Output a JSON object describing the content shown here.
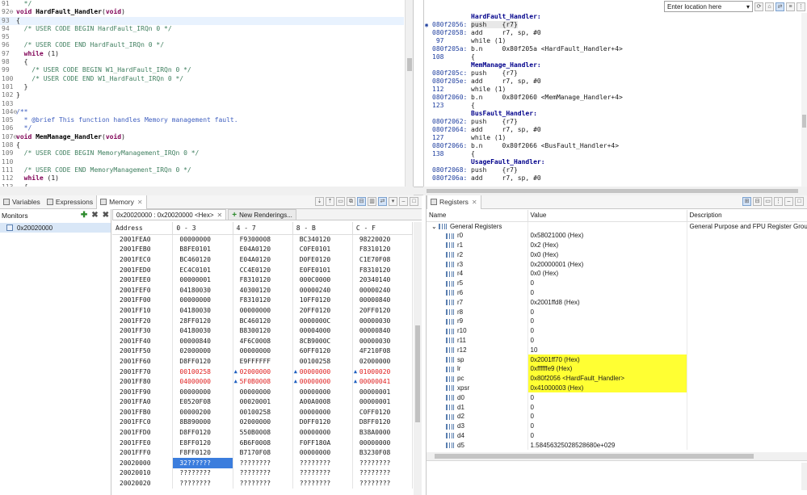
{
  "editor": {
    "lines": [
      {
        "n": "91",
        "fold": "",
        "parts": [
          [
            "cm",
            "  */"
          ]
        ]
      },
      {
        "n": "92",
        "fold": "⊖",
        "parts": [
          [
            "kw",
            "void "
          ],
          [
            "fn",
            "HardFault_Handler"
          ],
          [
            "",
            "("
          ],
          [
            "kw",
            "void"
          ],
          [
            "",
            ")"
          ]
        ]
      },
      {
        "n": "93",
        "fold": "",
        "cur": true,
        "parts": [
          [
            "",
            "{"
          ]
        ]
      },
      {
        "n": "94",
        "fold": "",
        "parts": [
          [
            "cm",
            "  /* USER CODE BEGIN HardFault_IRQn 0 */"
          ]
        ]
      },
      {
        "n": "95",
        "fold": "",
        "parts": [
          [
            "",
            ""
          ]
        ]
      },
      {
        "n": "96",
        "fold": "",
        "parts": [
          [
            "cm",
            "  /* USER CODE END HardFault_IRQn 0 */"
          ]
        ]
      },
      {
        "n": "97",
        "fold": "",
        "parts": [
          [
            "kw",
            "  while"
          ],
          [
            "",
            " (1)"
          ]
        ]
      },
      {
        "n": "98",
        "fold": "",
        "parts": [
          [
            "",
            "  {"
          ]
        ]
      },
      {
        "n": "99",
        "fold": "",
        "parts": [
          [
            "cm",
            "    /* USER CODE BEGIN W1_HardFault_IRQn 0 */"
          ]
        ]
      },
      {
        "n": "100",
        "fold": "",
        "parts": [
          [
            "cm",
            "    /* USER CODE END W1_HardFault_IRQn 0 */"
          ]
        ]
      },
      {
        "n": "101",
        "fold": "",
        "parts": [
          [
            "",
            "  }"
          ]
        ]
      },
      {
        "n": "102",
        "fold": "",
        "parts": [
          [
            "",
            "}"
          ]
        ]
      },
      {
        "n": "103",
        "fold": "",
        "parts": [
          [
            "",
            ""
          ]
        ]
      },
      {
        "n": "104",
        "fold": "⊖",
        "parts": [
          [
            "doc",
            "/**"
          ]
        ]
      },
      {
        "n": "105",
        "fold": "",
        "parts": [
          [
            "doc",
            "  * @brief This function handles Memory management fault."
          ]
        ]
      },
      {
        "n": "106",
        "fold": "",
        "parts": [
          [
            "doc",
            "  */"
          ]
        ]
      },
      {
        "n": "107",
        "fold": "⊖",
        "parts": [
          [
            "kw",
            "void "
          ],
          [
            "fn",
            "MemManage_Handler"
          ],
          [
            "",
            "("
          ],
          [
            "kw",
            "void"
          ],
          [
            "",
            ")"
          ]
        ]
      },
      {
        "n": "108",
        "fold": "",
        "parts": [
          [
            "",
            "{"
          ]
        ]
      },
      {
        "n": "109",
        "fold": "",
        "parts": [
          [
            "cm",
            "  /* USER CODE BEGIN MemoryManagement_IRQn 0 */"
          ]
        ]
      },
      {
        "n": "110",
        "fold": "",
        "parts": [
          [
            "",
            ""
          ]
        ]
      },
      {
        "n": "111",
        "fold": "",
        "parts": [
          [
            "cm",
            "  /* USER CODE END MemoryManagement_IRQn 0 */"
          ]
        ]
      },
      {
        "n": "112",
        "fold": "",
        "parts": [
          [
            "kw",
            "  while"
          ],
          [
            "",
            " (1)"
          ]
        ]
      },
      {
        "n": "113",
        "fold": "",
        "parts": [
          [
            "",
            "  {"
          ]
        ]
      }
    ]
  },
  "disassembly": {
    "location_placeholder": "Enter location here",
    "lines": [
      {
        "addr": "",
        "label": "HardFault_Handler:"
      },
      {
        "addr": "080f2056:",
        "marker": "◉",
        "cur": true,
        "ins": "push    {r7}"
      },
      {
        "addr": "080f2058:",
        "ins": "add     r7, sp, #0"
      },
      {
        "addr": " 97",
        "src": "while (1)"
      },
      {
        "addr": "080f205a:",
        "ins": "b.n     0x80f205a <HardFault_Handler+4>"
      },
      {
        "addr": "108",
        "src": "{"
      },
      {
        "addr": "",
        "label": "MemManage_Handler:"
      },
      {
        "addr": "080f205c:",
        "ins": "push    {r7}"
      },
      {
        "addr": "080f205e:",
        "ins": "add     r7, sp, #0"
      },
      {
        "addr": "112",
        "src": "while (1)"
      },
      {
        "addr": "080f2060:",
        "ins": "b.n     0x80f2060 <MemManage_Handler+4>"
      },
      {
        "addr": "123",
        "src": "{"
      },
      {
        "addr": "",
        "label": "BusFault_Handler:"
      },
      {
        "addr": "080f2062:",
        "ins": "push    {r7}"
      },
      {
        "addr": "080f2064:",
        "ins": "add     r7, sp, #0"
      },
      {
        "addr": "127",
        "src": "while (1)"
      },
      {
        "addr": "080f2066:",
        "ins": "b.n     0x80f2066 <BusFault_Handler+4>"
      },
      {
        "addr": "138",
        "src": "{"
      },
      {
        "addr": "",
        "label": "UsageFault_Handler:"
      },
      {
        "addr": "080f2068:",
        "ins": "push    {r7}"
      },
      {
        "addr": "080f206a:",
        "ins": "add     r7, sp, #0"
      }
    ]
  },
  "views": {
    "tabs": [
      {
        "label": "Variables",
        "active": false
      },
      {
        "label": "Expressions",
        "active": false
      },
      {
        "label": "Memory",
        "active": true
      }
    ],
    "monitors_label": "Monitors",
    "monitor_item": "0x20020000",
    "rendering_tab": "0x20020000 : 0x20020000 <Hex>",
    "new_renderings": "New Renderings...",
    "columns": [
      "Address",
      "0 - 3",
      "4 - 7",
      "8 - B",
      "C - F"
    ],
    "rows": [
      [
        "2001FEA0",
        "00000000",
        "F9300008",
        "BC340120",
        "98220020"
      ],
      [
        "2001FEB0",
        "B8FE0101",
        "E04A0120",
        "C0FE0101",
        "F8310120"
      ],
      [
        "2001FEC0",
        "BC460120",
        "E04A0120",
        "D0FE0120",
        "C1E70F08"
      ],
      [
        "2001FED0",
        "EC4C0101",
        "CC4E0120",
        "E0FE0101",
        "F8310120"
      ],
      [
        "2001FEE0",
        "00000001",
        "F8310120",
        "000C0000",
        "20340140"
      ],
      [
        "2001FEF0",
        "04180030",
        "40300120",
        "00000240",
        "00000240"
      ],
      [
        "2001FF00",
        "00000000",
        "F8310120",
        "10FF0120",
        "00000840"
      ],
      [
        "2001FF10",
        "04180030",
        "00000000",
        "20FF0120",
        "20FF0120"
      ],
      [
        "2001FF20",
        "28FF0120",
        "BC460120",
        "0000000C",
        "00000030"
      ],
      [
        "2001FF30",
        "04180030",
        "B8300120",
        "00004000",
        "00000840"
      ],
      [
        "2001FF40",
        "00000840",
        "4F6C0008",
        "8CB9000C",
        "00000030"
      ],
      [
        "2001FF50",
        "02000000",
        "00000000",
        "60FF0120",
        "4F210F08"
      ],
      [
        "2001FF60",
        "D8FF0120",
        "E9FFFFFF",
        "00100258",
        "02000000"
      ],
      [
        "2001FF70",
        "00100258",
        "02000000",
        "00000000",
        "01000020"
      ],
      [
        "2001FF80",
        "04000000",
        "5F0B0008",
        "00000000",
        "00000041"
      ],
      [
        "2001FF90",
        "00000000",
        "00000000",
        "00000000",
        "00000001"
      ],
      [
        "2001FFA0",
        "E0520F08",
        "00020001",
        "A00A0008",
        "00000001"
      ],
      [
        "2001FFB0",
        "00000200",
        "00100258",
        "00000000",
        "C0FF0120"
      ],
      [
        "2001FFC0",
        "8B890000",
        "02000000",
        "D0FF0120",
        "D8FF0120"
      ],
      [
        "2001FFD0",
        "D8FF0120",
        "550B0008",
        "00000000",
        "B38A0000"
      ],
      [
        "2001FFE0",
        "E8FF0120",
        "6B6F0008",
        "F0FF180A",
        "00000000"
      ],
      [
        "2001FFF0",
        "F8FF0120",
        "B7170F08",
        "00000000",
        "B3230F08"
      ],
      [
        "20020000",
        "32??????",
        "????????",
        "????????",
        "????????"
      ],
      [
        "20020010",
        "????????",
        "????????",
        "????????",
        "????????"
      ],
      [
        "20020020",
        "????????",
        "????????",
        "????????",
        "????????"
      ]
    ]
  },
  "registers": {
    "tab_label": "Registers",
    "columns": [
      "Name",
      "Value",
      "Description"
    ],
    "group": {
      "name": "General Registers",
      "description": "General Purpose and FPU Register Group"
    },
    "rows": [
      {
        "name": "r0",
        "value": "0x58021000 (Hex)"
      },
      {
        "name": "r1",
        "value": "0x2 (Hex)"
      },
      {
        "name": "r2",
        "value": "0x0 (Hex)"
      },
      {
        "name": "r3",
        "value": "0x20000001 (Hex)"
      },
      {
        "name": "r4",
        "value": "0x0 (Hex)"
      },
      {
        "name": "r5",
        "value": "0"
      },
      {
        "name": "r6",
        "value": "0"
      },
      {
        "name": "r7",
        "value": "0x2001ffd8 (Hex)"
      },
      {
        "name": "r8",
        "value": "0"
      },
      {
        "name": "r9",
        "value": "0"
      },
      {
        "name": "r10",
        "value": "0"
      },
      {
        "name": "r11",
        "value": "0"
      },
      {
        "name": "r12",
        "value": "10"
      },
      {
        "name": "sp",
        "value": "0x2001ff70 (Hex)",
        "hl": true
      },
      {
        "name": "lr",
        "value": "0xffffffe9 (Hex)",
        "hl": true
      },
      {
        "name": "pc",
        "value": "0x80f2056 <HardFault_Handler>",
        "hl": true
      },
      {
        "name": "xpsr",
        "value": "0x41000003 (Hex)",
        "hl": true
      },
      {
        "name": "d0",
        "value": "0"
      },
      {
        "name": "d1",
        "value": "0"
      },
      {
        "name": "d2",
        "value": "0"
      },
      {
        "name": "d3",
        "value": "0"
      },
      {
        "name": "d4",
        "value": "0"
      },
      {
        "name": "d5",
        "value": "1.58456325028528680e+029"
      }
    ]
  },
  "colors": {
    "changed_text": "#e02020",
    "selected_cell": "#3b7ddd",
    "changed_register": "#ffff33"
  }
}
